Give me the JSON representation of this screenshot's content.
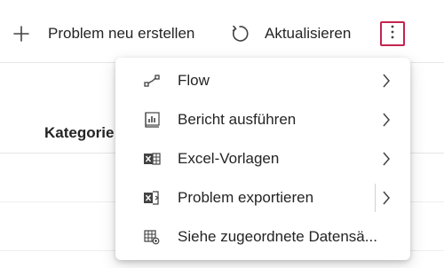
{
  "toolbar": {
    "new_problem_label": "Problem neu erstellen",
    "refresh_label": "Aktualisieren",
    "new_problem_icon": "plus-icon",
    "refresh_icon": "refresh-icon",
    "more_icon": "more-vertical-icon",
    "more_highlight_color": "#c5234f"
  },
  "grid": {
    "columns": [
      "Kategorie"
    ]
  },
  "menu": {
    "items": [
      {
        "label": "Flow",
        "icon": "flow-icon",
        "has_submenu": true
      },
      {
        "label": "Bericht ausführen",
        "icon": "report-icon",
        "has_submenu": true
      },
      {
        "label": "Excel-Vorlagen",
        "icon": "excel-templates-icon",
        "has_submenu": true
      },
      {
        "label": "Problem exportieren",
        "icon": "excel-export-icon",
        "has_submenu": true,
        "split_button": true
      },
      {
        "label": "Siehe zugeordnete Datensä...",
        "icon": "related-records-icon",
        "has_submenu": false
      }
    ]
  }
}
